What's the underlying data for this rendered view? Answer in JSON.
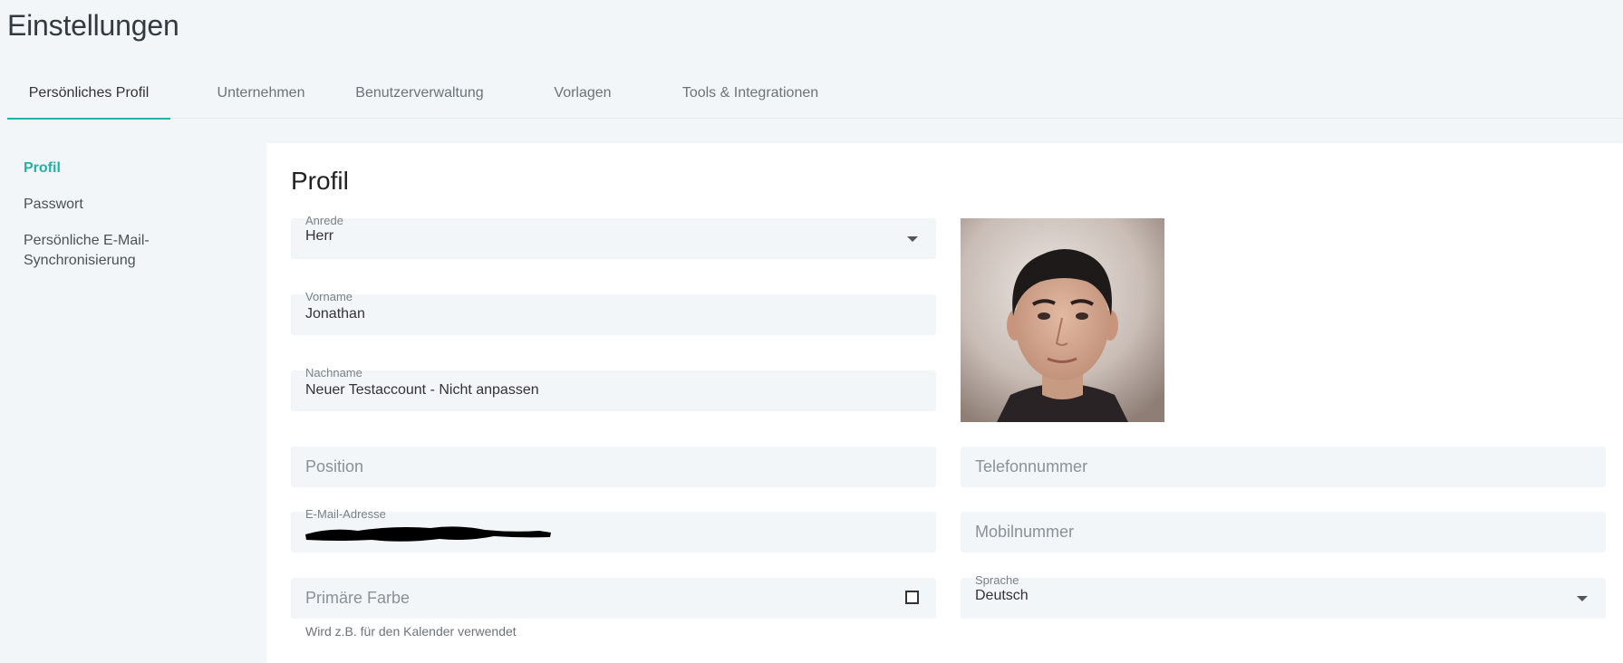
{
  "page": {
    "title": "Einstellungen"
  },
  "tabs": [
    {
      "label": "Persönliches Profil",
      "active": true
    },
    {
      "label": "Unternehmen",
      "active": false
    },
    {
      "label": "Benutzerverwaltung",
      "active": false
    },
    {
      "label": "Vorlagen",
      "active": false
    },
    {
      "label": "Tools & Integrationen",
      "active": false
    }
  ],
  "sidebar": {
    "items": [
      {
        "label": "Profil",
        "active": true
      },
      {
        "label": "Passwort",
        "active": false
      },
      {
        "label": "Persönliche E-Mail-Synchronisierung",
        "active": false
      }
    ]
  },
  "profile": {
    "title": "Profil",
    "salutation": {
      "label": "Anrede",
      "value": "Herr"
    },
    "first_name": {
      "label": "Vorname",
      "value": "Jonathan"
    },
    "last_name": {
      "label": "Nachname",
      "value": "Neuer Testaccount - Nicht anpassen"
    },
    "position": {
      "placeholder": "Position"
    },
    "phone": {
      "placeholder": "Telefonnummer"
    },
    "email": {
      "label": "E-Mail-Adresse"
    },
    "mobile": {
      "placeholder": "Mobilnummer"
    },
    "primary_color": {
      "placeholder": "Primäre Farbe",
      "hint": "Wird z.B. für den Kalender verwendet"
    },
    "language": {
      "label": "Sprache",
      "value": "Deutsch"
    }
  },
  "colors": {
    "accent": "#20b2a6",
    "background": "#f2f6f8",
    "panel": "#ffffff"
  }
}
